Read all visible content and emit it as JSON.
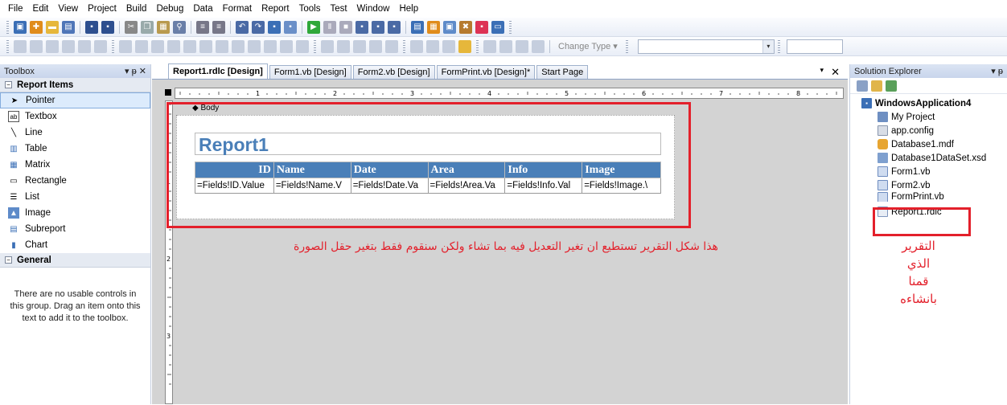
{
  "menu": [
    "File",
    "Edit",
    "View",
    "Project",
    "Build",
    "Debug",
    "Data",
    "Format",
    "Report",
    "Tools",
    "Test",
    "Window",
    "Help"
  ],
  "toolbar": {
    "change_type_label": "Change Type",
    "icons_row1": [
      "new-project-icon",
      "add-item-icon",
      "open-file-icon",
      "save-icon",
      "save-all-icon",
      "cut-icon",
      "copy-icon",
      "paste-icon",
      "undo-icon",
      "redo-icon",
      "start-debug-icon",
      "pause-icon",
      "stop-icon",
      "find-icon",
      "solution-explorer-icon",
      "properties-icon",
      "toolbox-icon"
    ],
    "icons_row2": [
      "bold-icon",
      "italic-icon",
      "underline-icon",
      "align-left-icon",
      "align-center-icon",
      "align-right-icon",
      "sum-icon",
      "table-icon",
      "chart-icon",
      "matrix-icon",
      "list-icon"
    ],
    "colors": {
      "accent": "#3b6fb6",
      "green": "#2fa83a",
      "orange": "#e08c1b"
    }
  },
  "toolbox": {
    "title": "Toolbox",
    "pin": "▾ ᵽ ✕",
    "group_report_items": "Report Items",
    "items": [
      {
        "label": "Pointer",
        "icon": "pointer-icon",
        "glyph": "➤"
      },
      {
        "label": "Textbox",
        "icon": "textbox-icon",
        "glyph": "ab"
      },
      {
        "label": "Line",
        "icon": "line-icon",
        "glyph": "╲"
      },
      {
        "label": "Table",
        "icon": "table-icon",
        "glyph": "▥"
      },
      {
        "label": "Matrix",
        "icon": "matrix-icon",
        "glyph": "▦"
      },
      {
        "label": "Rectangle",
        "icon": "rectangle-icon",
        "glyph": "▭"
      },
      {
        "label": "List",
        "icon": "list-icon",
        "glyph": "☰"
      },
      {
        "label": "Image",
        "icon": "image-icon",
        "glyph": "🖼"
      },
      {
        "label": "Subreport",
        "icon": "subreport-icon",
        "glyph": "▤"
      },
      {
        "label": "Chart",
        "icon": "chart-icon",
        "glyph": "▮"
      }
    ],
    "group_general": "General",
    "general_message": "There are no usable controls in this group. Drag an item onto this text to add it to the toolbox."
  },
  "tabs": [
    {
      "label": "Report1.rdlc [Design]",
      "active": true
    },
    {
      "label": "Form1.vb [Design]",
      "active": false
    },
    {
      "label": "Form2.vb [Design]",
      "active": false
    },
    {
      "label": "FormPrint.vb [Design]*",
      "active": false
    },
    {
      "label": "Start Page",
      "active": false
    }
  ],
  "tab_close": "✕",
  "tab_dropdown": "▾",
  "designer": {
    "body_label": "Body",
    "report_title": "Report1",
    "table_headers": [
      "ID",
      "Name",
      "Date",
      "Area",
      "Info",
      "Image"
    ],
    "table_cells": [
      "=Fields!ID.Value",
      "=Fields!Name.V",
      "=Fields!Date.Va",
      "=Fields!Area.Va",
      "=Fields!Info.Val",
      "=Fields!Image.\\"
    ],
    "ruler_numbers": [
      "1",
      "2",
      "3",
      "4",
      "5",
      "6",
      "7",
      "8"
    ],
    "vruler_numbers": [
      "1",
      "2",
      "3"
    ]
  },
  "annotations": {
    "main": "هذا شكل التقرير تستطيع ان تغير التعديل فيه بما تشاء ولكن  سنقوم فقط بتغير حقل الصورة",
    "side_lines": [
      "التقرير",
      "الذي",
      "قمنا",
      "بانشاءه"
    ],
    "color": "#e3202b"
  },
  "solution_explorer": {
    "title": "Solution Explorer",
    "pin": "▾ ᵽ",
    "root": "WindowsApplication4",
    "items": [
      {
        "label": "My Project",
        "icon": "my-project-icon"
      },
      {
        "label": "app.config",
        "icon": "config-file-icon"
      },
      {
        "label": "Database1.mdf",
        "icon": "database-icon"
      },
      {
        "label": "Database1DataSet.xsd",
        "icon": "dataset-icon"
      },
      {
        "label": "Form1.vb",
        "icon": "form-icon"
      },
      {
        "label": "Form2.vb",
        "icon": "form-icon"
      },
      {
        "label": "FormPrint.vb",
        "icon": "form-icon"
      },
      {
        "label": "Report1.rdlc",
        "icon": "report-icon"
      }
    ]
  }
}
